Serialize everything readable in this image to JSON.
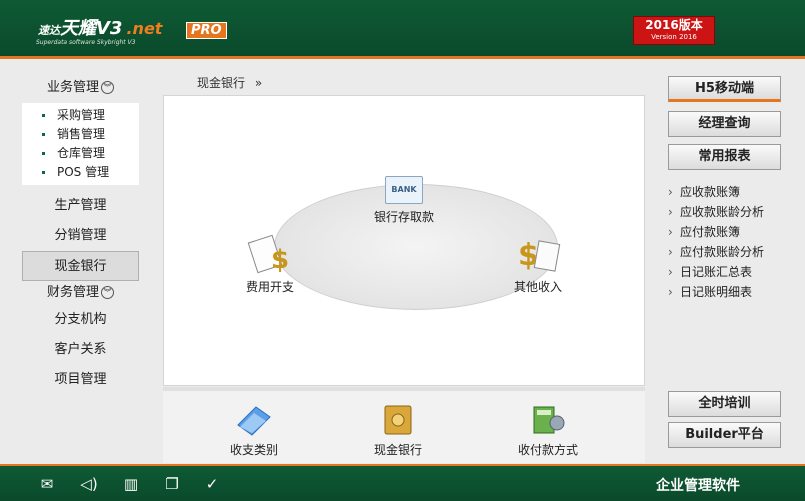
{
  "header": {
    "logo_cn": "速达",
    "logo_main": "天耀V3",
    "logo_net": ".net",
    "logo_pro": "PRO",
    "logo_sub": "Superdata software Skybright V3",
    "version_main": "2016版本",
    "version_sub": "Version 2016"
  },
  "sidebar": {
    "business": {
      "title": "业务管理",
      "items": [
        "采购管理",
        "销售管理",
        "仓库管理",
        "POS 管理"
      ]
    },
    "items": [
      "生产管理",
      "分销管理",
      "现金银行"
    ],
    "finance": {
      "title": "财务管理"
    },
    "items2": [
      "分支机构",
      "客户关系",
      "项目管理"
    ]
  },
  "breadcrumb": {
    "label": "现金银行",
    "arrow": "»"
  },
  "flow": {
    "bank_badge": "BANK",
    "bank_label": "银行存取款",
    "expense_label": "费用开支",
    "income_label": "其他收入"
  },
  "bottom": {
    "items": [
      "收支类别",
      "现金银行",
      "收付款方式"
    ]
  },
  "right": {
    "h5": "H5移动端",
    "manager": "经理查询",
    "reports": "常用报表",
    "report_items": [
      "应收款账簿",
      "应收款账龄分析",
      "应付款账簿",
      "应付款账龄分析",
      "日记账汇总表",
      "日记账明细表"
    ],
    "training": "全时培训",
    "builder": "Builder平台"
  },
  "footer": {
    "title": "企业管理软件"
  }
}
